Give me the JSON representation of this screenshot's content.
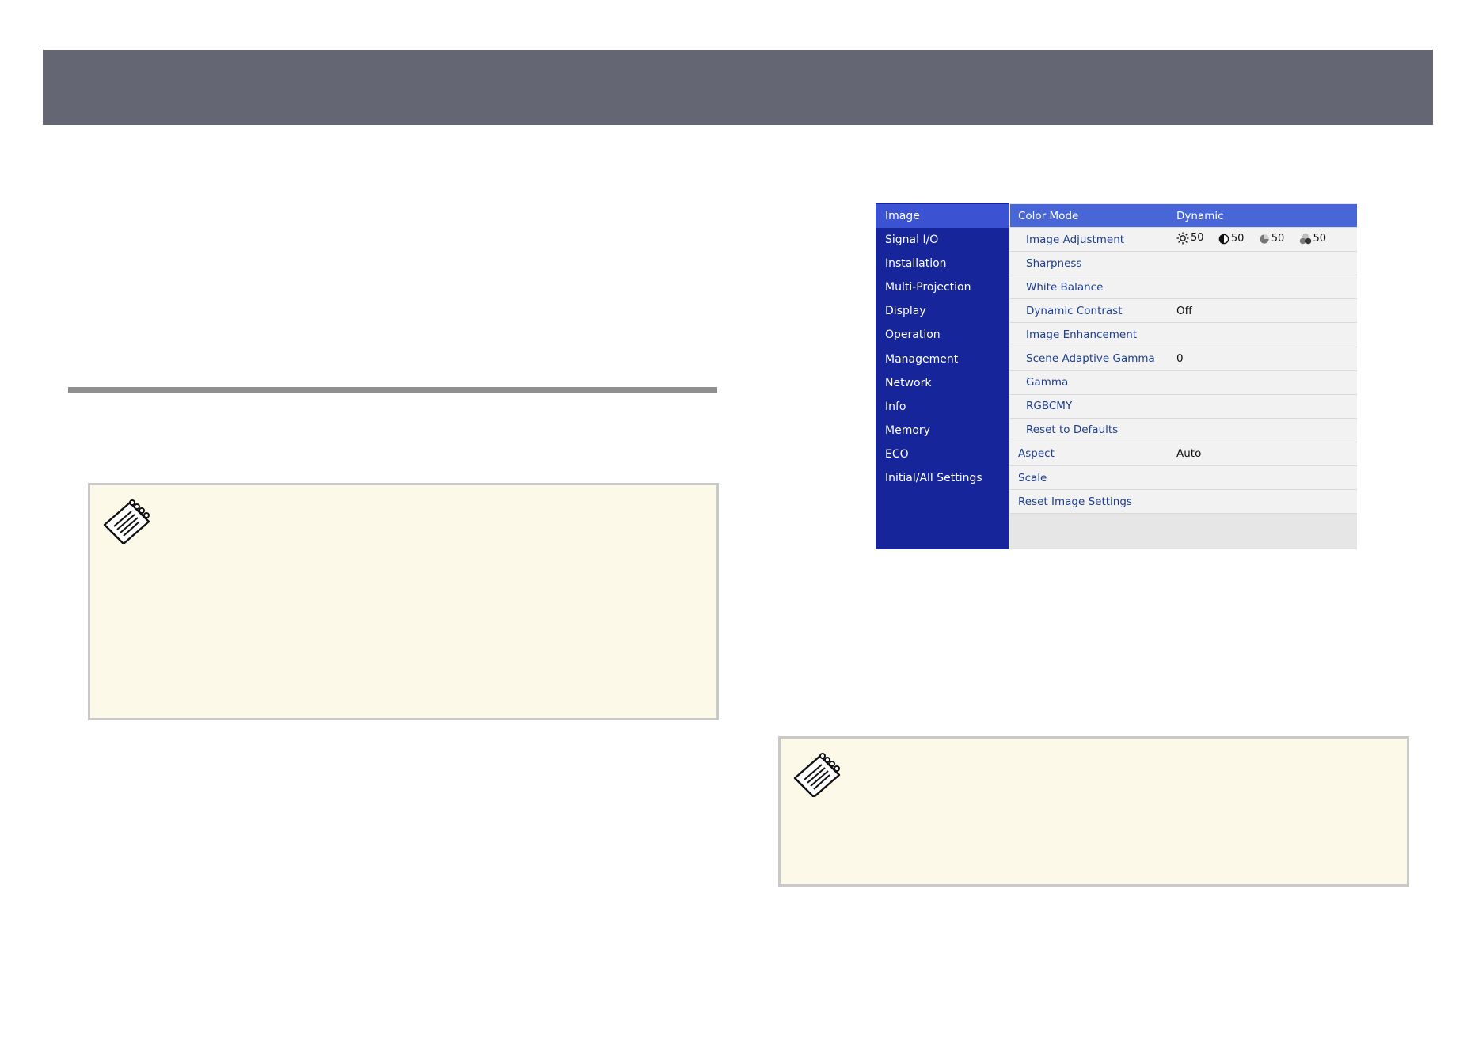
{
  "osd": {
    "sidebar": [
      {
        "label": "Image",
        "active": true
      },
      {
        "label": "Signal I/O",
        "active": false
      },
      {
        "label": "Installation",
        "active": false
      },
      {
        "label": "Multi-Projection",
        "active": false
      },
      {
        "label": "Display",
        "active": false
      },
      {
        "label": "Operation",
        "active": false
      },
      {
        "label": "Management",
        "active": false
      },
      {
        "label": "Network",
        "active": false
      },
      {
        "label": "Info",
        "active": false
      },
      {
        "label": "Memory",
        "active": false
      },
      {
        "label": "ECO",
        "active": false
      },
      {
        "label": "Initial/All Settings",
        "active": false
      }
    ],
    "rows": [
      {
        "label": "Color Mode",
        "value": "Dynamic"
      },
      {
        "label": "Image Adjustment",
        "value": ""
      },
      {
        "label": "Sharpness",
        "value": ""
      },
      {
        "label": "White Balance",
        "value": ""
      },
      {
        "label": "Dynamic Contrast",
        "value": "Off"
      },
      {
        "label": "Image Enhancement",
        "value": ""
      },
      {
        "label": "Scene Adaptive Gamma",
        "value": "0"
      },
      {
        "label": "Gamma",
        "value": ""
      },
      {
        "label": "RGBCMY",
        "value": ""
      },
      {
        "label": "Reset to Defaults",
        "value": ""
      },
      {
        "label": "Aspect",
        "value": "Auto"
      },
      {
        "label": "Scale",
        "value": ""
      },
      {
        "label": "Reset Image Settings",
        "value": ""
      }
    ],
    "image_adjustment": {
      "brightness": "50",
      "contrast": "50",
      "color_saturation": "50",
      "tint": "50"
    },
    "colors": {
      "sidebar_bg": "#16259a",
      "sidebar_active": "#3b53d3",
      "row_selected": "#4966d6",
      "row_text": "#1e3f91"
    }
  },
  "icons": {
    "note_left": "note-pad-icon",
    "note_right": "note-pad-icon",
    "brightness": "sun-icon",
    "contrast": "half-circle-icon",
    "saturation": "pie-icon",
    "tint": "three-circles-icon"
  }
}
